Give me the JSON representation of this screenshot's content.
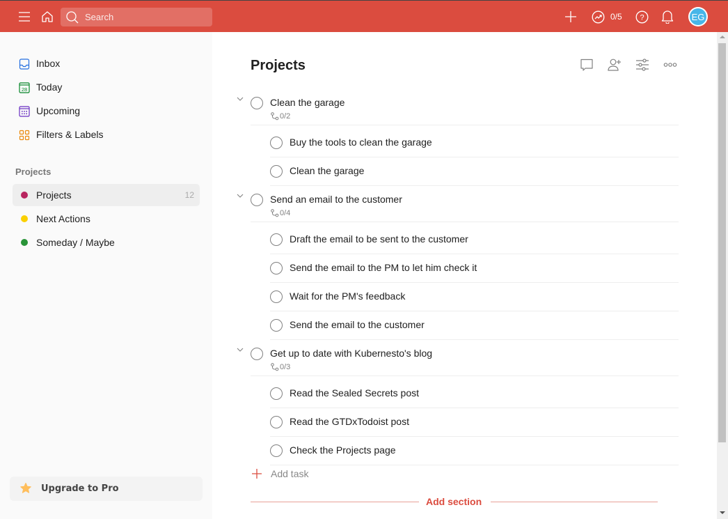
{
  "topbar": {
    "search_placeholder": "Search",
    "karma": "0/5",
    "avatar_initials": "EG",
    "brand_color": "#db4c3f"
  },
  "sidebar": {
    "nav": [
      {
        "label": "Inbox",
        "icon": "inbox-icon",
        "color": "#246fe0"
      },
      {
        "label": "Today",
        "icon": "calendar-today-icon",
        "color": "#058527",
        "day": "28"
      },
      {
        "label": "Upcoming",
        "icon": "calendar-upcoming-icon",
        "color": "#692fc2"
      },
      {
        "label": "Filters & Labels",
        "icon": "filters-labels-icon",
        "color": "#eb8909"
      }
    ],
    "projects_heading": "Projects",
    "projects": [
      {
        "label": "Projects",
        "count": "12",
        "color": "#b8255f"
      },
      {
        "label": "Next Actions",
        "count": "",
        "color": "#fad000"
      },
      {
        "label": "Someday / Maybe",
        "count": "",
        "color": "#299438"
      }
    ],
    "upgrade_label": "Upgrade to Pro"
  },
  "main": {
    "title": "Projects",
    "groups": [
      {
        "title": "Clean the garage",
        "progress": "0/2",
        "subtasks": [
          "Buy the tools to clean the garage",
          "Clean the garage"
        ]
      },
      {
        "title": "Send an email to the customer",
        "progress": "0/4",
        "subtasks": [
          "Draft the email to be sent to the customer",
          "Send the email to the PM to let him check it",
          "Wait for the PM's feedback",
          "Send the email to the customer"
        ]
      },
      {
        "title": "Get up to date with Kubernesto's blog",
        "progress": "0/3",
        "subtasks": [
          "Read the Sealed Secrets post",
          "Read the GTDxTodoist post",
          "Check the Projects page"
        ]
      }
    ],
    "add_task_label": "Add task",
    "add_section_label": "Add section"
  }
}
